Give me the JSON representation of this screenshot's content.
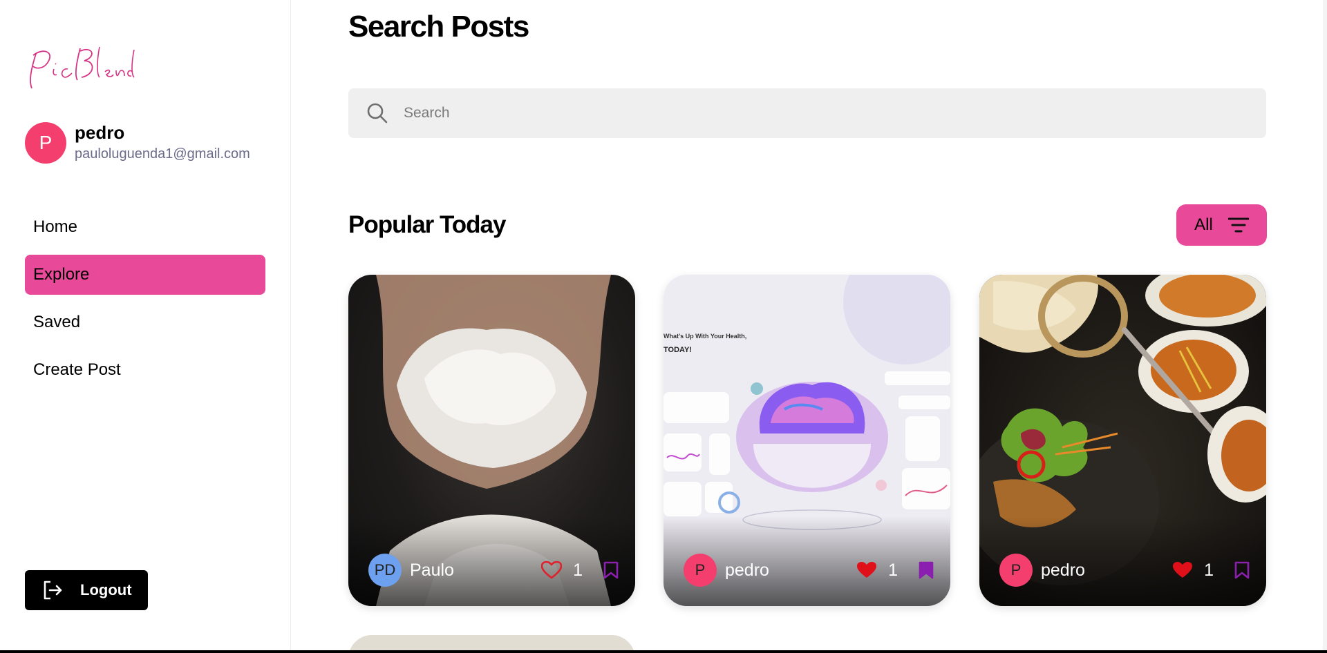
{
  "app": {
    "logo_text": "PicBlend",
    "accent_color": "#e84a99"
  },
  "user": {
    "initial": "P",
    "name": "pedro",
    "email": "pauloluguenda1@gmail.com"
  },
  "nav": {
    "items": [
      {
        "label": "Home",
        "active": false
      },
      {
        "label": "Explore",
        "active": true
      },
      {
        "label": "Saved",
        "active": false
      },
      {
        "label": "Create Post",
        "active": false
      }
    ],
    "logout_label": "Logout"
  },
  "page": {
    "title": "Search Posts",
    "search_placeholder": "Search",
    "section_title": "Popular Today",
    "filter_label": "All"
  },
  "posts": [
    {
      "author_initials": "PD",
      "author": "Paulo",
      "likes": "1",
      "liked": false,
      "saved": false,
      "avatar_color": "#6ea0f0",
      "image": "flour-hands"
    },
    {
      "author_initials": "P",
      "author": "pedro",
      "likes": "1",
      "liked": true,
      "saved": true,
      "avatar_color": "#f43f6e",
      "image": "health-dashboard-ui"
    },
    {
      "author_initials": "P",
      "author": "pedro",
      "likes": "1",
      "liked": true,
      "saved": false,
      "avatar_color": "#f43f6e",
      "image": "indian-food"
    }
  ]
}
